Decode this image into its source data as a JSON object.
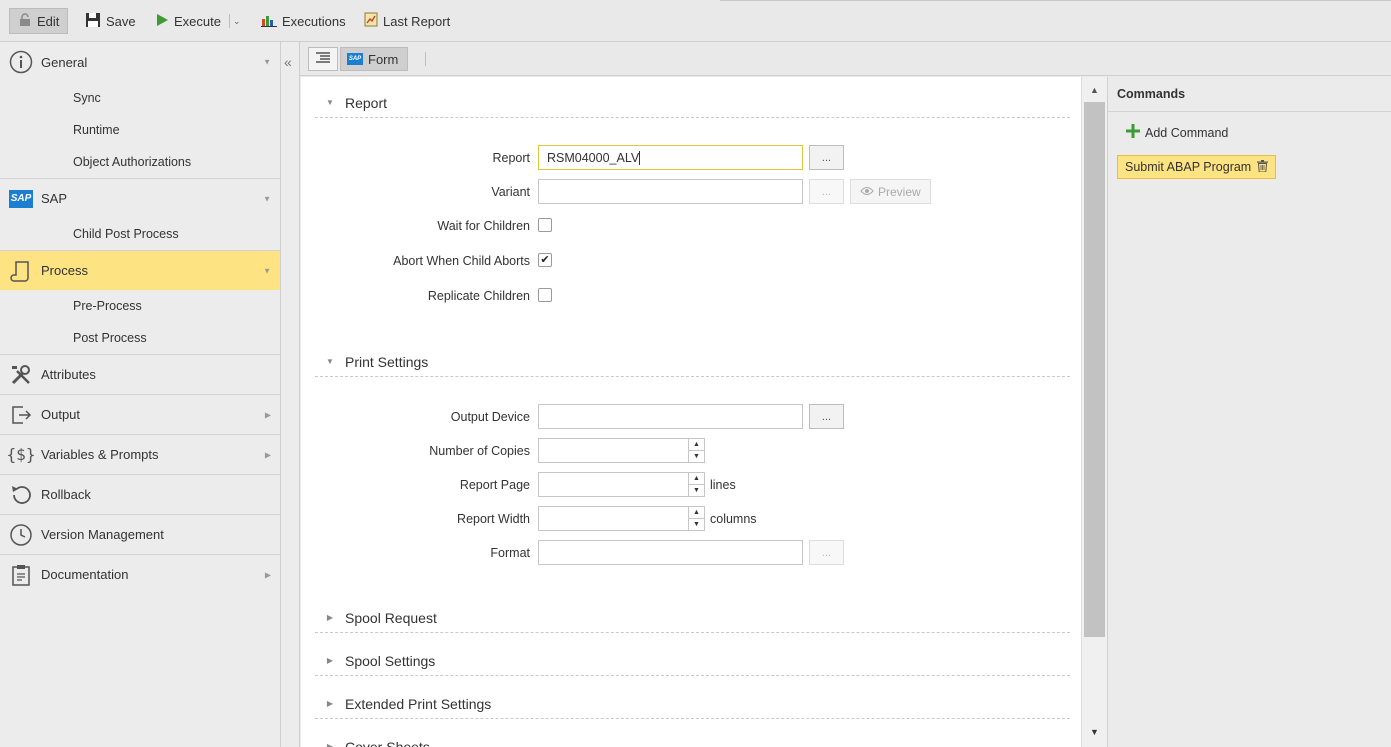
{
  "toolbar": {
    "edit": "Edit",
    "save": "Save",
    "execute": "Execute",
    "executions": "Executions",
    "last_report": "Last Report"
  },
  "sidebar": {
    "general": "General",
    "general_items": [
      "Sync",
      "Runtime",
      "Object Authorizations"
    ],
    "sap": "SAP",
    "sap_items": [
      "Child Post Process"
    ],
    "process": "Process",
    "process_items": [
      "Pre-Process",
      "Post Process"
    ],
    "attributes": "Attributes",
    "output": "Output",
    "variables": "Variables & Prompts",
    "rollback": "Rollback",
    "version": "Version Management",
    "documentation": "Documentation"
  },
  "tabs": {
    "sap_badge": "SAP",
    "form": "Form"
  },
  "form": {
    "report_section": "Report",
    "report_label": "Report",
    "report_value": "RSM04000_ALV",
    "dots": "...",
    "variant_label": "Variant",
    "variant_value": "",
    "preview": "Preview",
    "wait_label": "Wait for Children",
    "wait_checked": false,
    "abort_label": "Abort When Child Aborts",
    "abort_checked": true,
    "replicate_label": "Replicate Children",
    "replicate_checked": false,
    "print_section": "Print Settings",
    "output_device_label": "Output Device",
    "copies_label": "Number of Copies",
    "page_label": "Report Page",
    "page_unit": "lines",
    "width_label": "Report Width",
    "width_unit": "columns",
    "format_label": "Format",
    "spool_request": "Spool Request",
    "spool_settings": "Spool Settings",
    "extended_print": "Extended Print Settings",
    "cover_sheets": "Cover Sheets"
  },
  "commands": {
    "title": "Commands",
    "add": "Add Command",
    "items": [
      "Submit ABAP Program"
    ]
  },
  "colors": {
    "selected_bg": "#fde382",
    "accent_border": "#e3c43d",
    "play_green": "#3d9b35",
    "sap_blue": "#1a7fd0"
  }
}
